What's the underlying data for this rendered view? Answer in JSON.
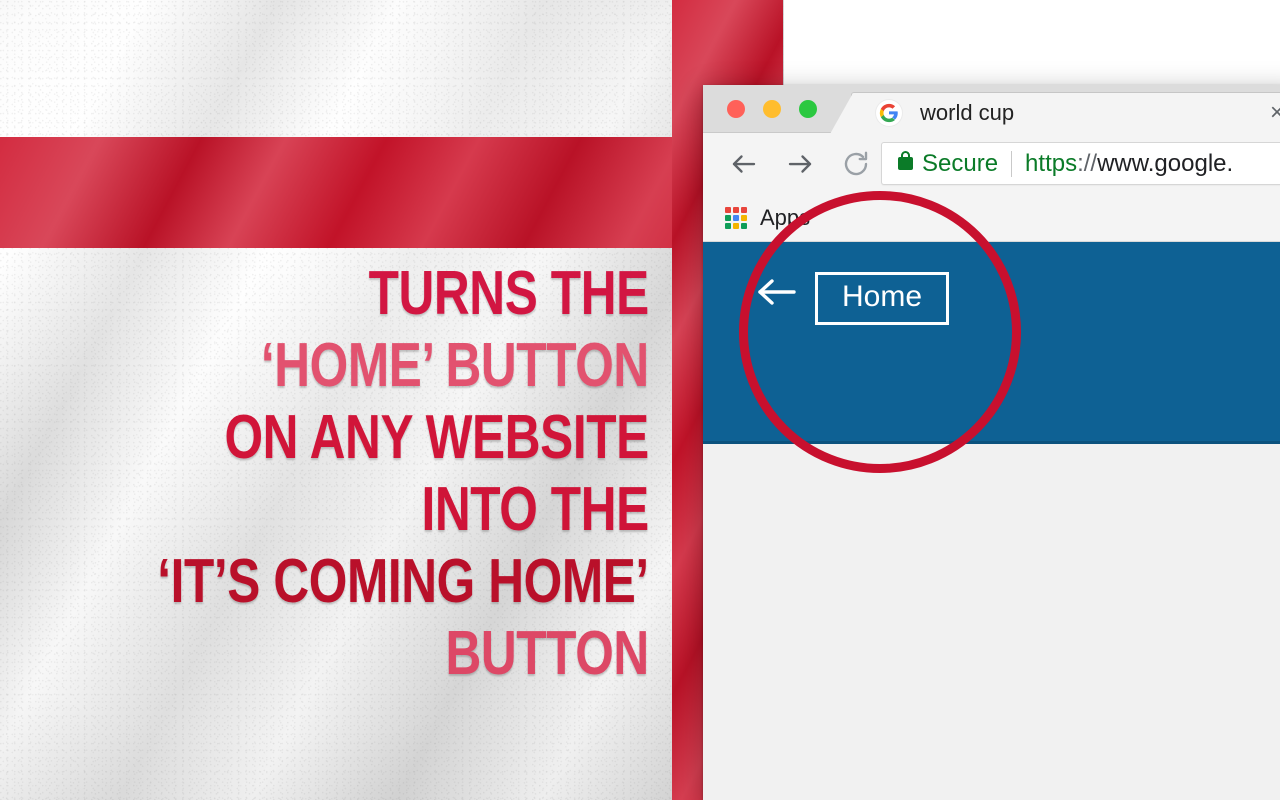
{
  "poster": {
    "flag_name": "england-flag",
    "flag_white": "#f2f2f2",
    "flag_red": "#ce142b",
    "headline_lines": [
      "TURNS THE",
      "‘HOME’ BUTTON",
      "ON ANY WEBSITE",
      "INTO THE",
      "‘IT’S COMING HOME’",
      "BUTTON"
    ]
  },
  "browser": {
    "window_controls": {
      "close_label": "close",
      "minimize_label": "minimize",
      "zoom_label": "zoom",
      "close_color": "#ff6159",
      "minimize_color": "#ffbd2e",
      "zoom_color": "#2bc840"
    },
    "tab": {
      "title": "world cup",
      "favicon": "google-favicon",
      "close_glyph": "×"
    },
    "toolbar": {
      "back_icon": "back-arrow-icon",
      "forward_icon": "forward-arrow-icon",
      "reload_icon": "reload-icon"
    },
    "omnibox": {
      "lock_icon": "lock-icon",
      "secure_label": "Secure",
      "url_scheme": "https",
      "url_separator": "://",
      "url_host": "www.google.",
      "security_color": "#0b7b28"
    },
    "bookmarks": [
      {
        "icon": "apps-grid-icon",
        "label": "Apps"
      }
    ],
    "apps_icon_colors": [
      "#e8453c",
      "#e8453c",
      "#e8453c",
      "#0f9d58",
      "#4285f4",
      "#f4b400",
      "#0f9d58",
      "#f4b400",
      "#0f9d58"
    ]
  },
  "site": {
    "bar_color": "#0e6194",
    "back_icon": "back-arrow-icon",
    "home_button_label": "Home"
  },
  "annotation": {
    "name": "highlight-circle",
    "color": "#c8102e"
  }
}
